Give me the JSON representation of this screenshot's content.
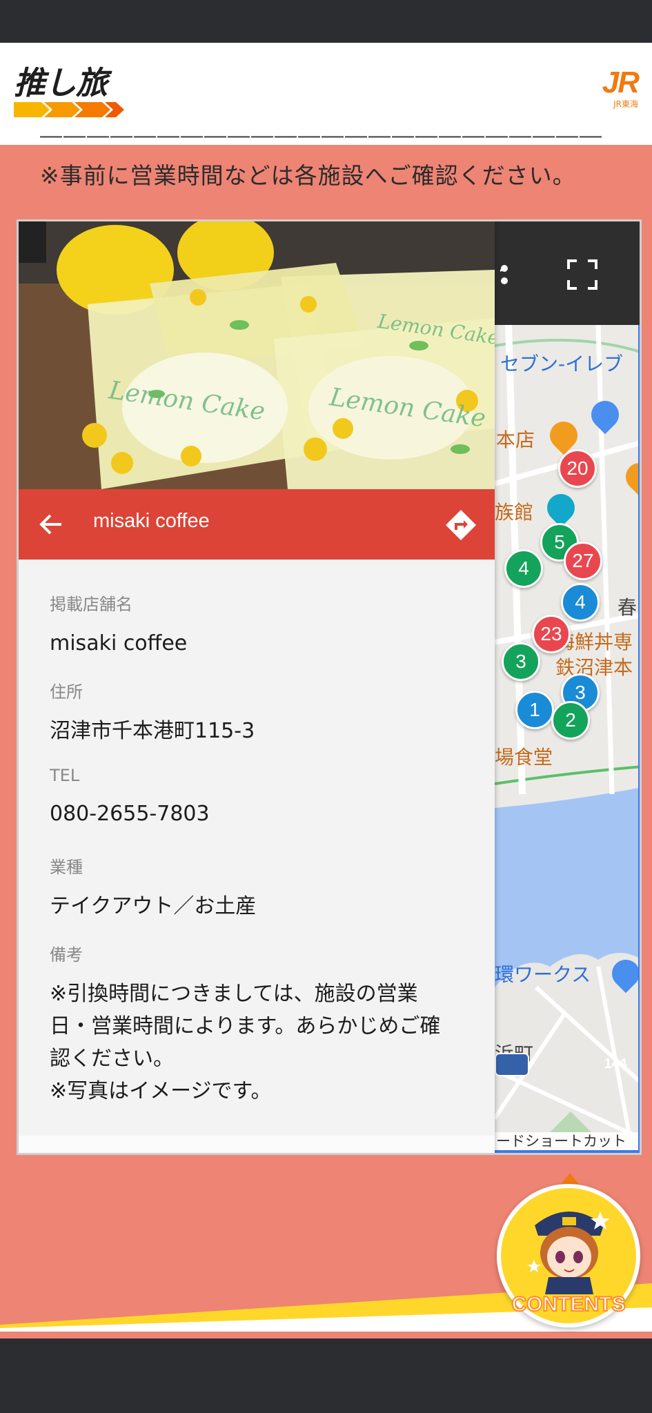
{
  "header": {
    "logo_text": "推し旅",
    "jr_logo": "JR",
    "jr_sub": "JR東海"
  },
  "notice": {
    "text": "※事前に営業時間などは各施設へご確認ください。"
  },
  "detail_panel": {
    "title": "misaki coffee",
    "fields": [
      {
        "label": "掲載店舗名",
        "value": "misaki coffee"
      },
      {
        "label": "住所",
        "value": "沼津市千本港町115-3"
      },
      {
        "label": "TEL",
        "value": "080-2655-7803"
      },
      {
        "label": "業種",
        "value": "テイクアウト／お土産"
      },
      {
        "label": "備考",
        "value_lines": [
          "※引換時間につきましては、施設の営業",
          "日・営業時間によります。あらかじめご確",
          "認ください。",
          "※写真はイメージです。"
        ]
      }
    ],
    "photo_watermarks": [
      "Lemon Cake",
      "Lemon Cake",
      "Lemon Cake"
    ]
  },
  "map": {
    "labels": [
      {
        "text": "セブン-イレブ",
        "style": "blue"
      },
      {
        "text": "本店",
        "style": "orange"
      },
      {
        "text": "族館",
        "style": "orange"
      },
      {
        "text": "春",
        "style": "dark"
      },
      {
        "text": "海鮮丼専",
        "style": "orange"
      },
      {
        "text": "鉄沼津本",
        "style": "orange"
      },
      {
        "text": "場食堂",
        "style": "orange"
      },
      {
        "text": "環ワークス",
        "style": "blue"
      },
      {
        "text": "浜町",
        "style": "dark"
      }
    ],
    "pins": [
      {
        "num": "20",
        "color": "red"
      },
      {
        "num": "5",
        "color": "green"
      },
      {
        "num": "27",
        "color": "red"
      },
      {
        "num": "4",
        "color": "green"
      },
      {
        "num": "4",
        "color": "blue"
      },
      {
        "num": "23",
        "color": "red"
      },
      {
        "num": "3",
        "color": "green"
      },
      {
        "num": "3",
        "color": "blue"
      },
      {
        "num": "1",
        "color": "blue"
      },
      {
        "num": "2",
        "color": "green"
      }
    ],
    "route_badge": "144",
    "shortcut_text": "ードショートカット"
  },
  "contents_button": {
    "label": "CONTENTS"
  },
  "colors": {
    "background": "#ee8474",
    "panel_header": "#dc4437",
    "accent_orange": "#f07a12",
    "contents_yellow": "#ffd72a"
  }
}
